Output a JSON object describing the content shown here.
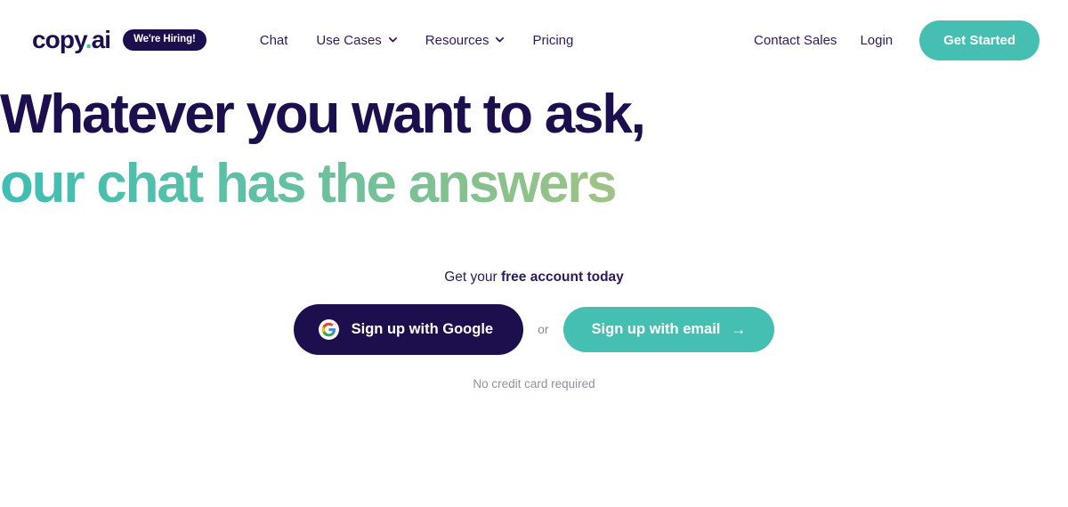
{
  "nav": {
    "logo": {
      "name": "copy",
      "dot": ".",
      "suffix": "ai"
    },
    "hiring_badge": "We're Hiring!",
    "links": [
      {
        "label": "Chat",
        "has_dropdown": false
      },
      {
        "label": "Use Cases",
        "has_dropdown": true
      },
      {
        "label": "Resources",
        "has_dropdown": true
      },
      {
        "label": "Pricing",
        "has_dropdown": false
      }
    ],
    "right_links": [
      {
        "label": "Contact Sales"
      },
      {
        "label": "Login"
      }
    ],
    "cta_button": "Get Started"
  },
  "hero": {
    "headline_line1": "Whatever you want to ask,",
    "headline_line2": "our chat has the answers"
  },
  "cta": {
    "label_regular": "Get your ",
    "label_bold": "free account today",
    "google_button": "Sign up with Google",
    "or": "or",
    "email_button": "Sign up with email",
    "email_arrow": "→",
    "footnote": "No credit card required"
  },
  "colors": {
    "navy": "#1d0f4e",
    "teal": "#45bfb2",
    "gradient_start": "#3dbeb4",
    "gradient_end": "#ddcb76",
    "muted_gray": "#8b919e",
    "background": "#ffffff"
  }
}
